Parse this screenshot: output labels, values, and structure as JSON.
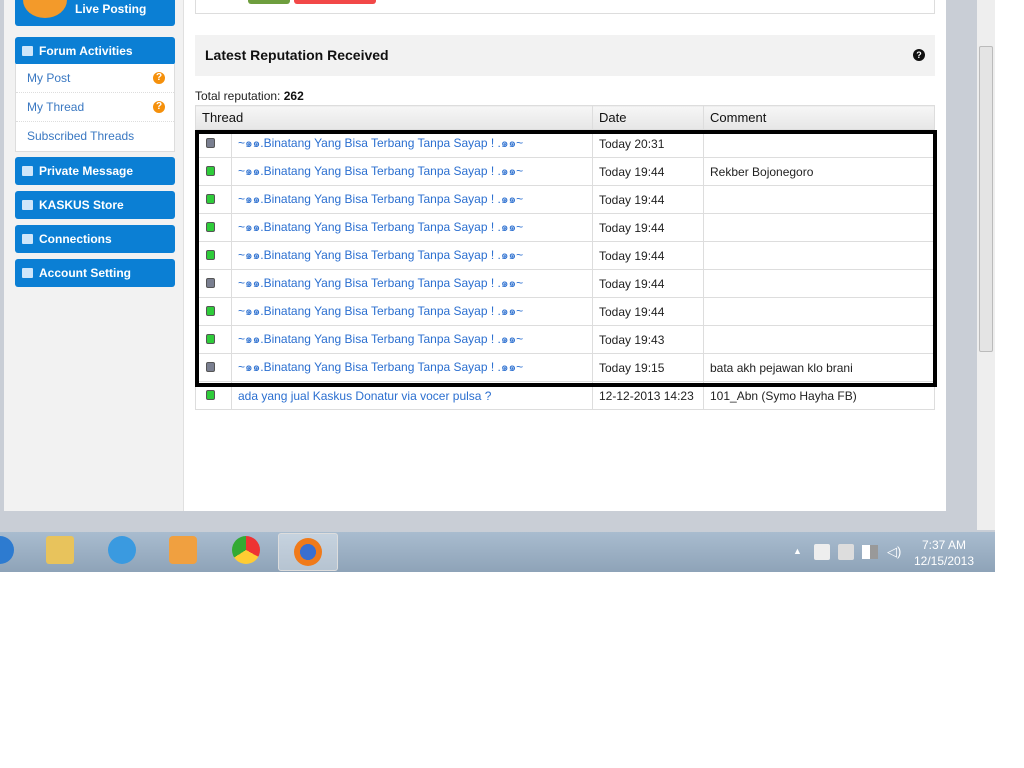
{
  "sidebar": {
    "live_posting": "Live Posting",
    "forum_activities": "Forum Activities",
    "sub_items": [
      {
        "label": "My Post",
        "badge": "?"
      },
      {
        "label": "My Thread",
        "badge": "?"
      },
      {
        "label": "Subscribed Threads"
      }
    ],
    "buttons": [
      "Private Message",
      "KASKUS Store",
      "Connections",
      "Account Setting"
    ]
  },
  "main": {
    "title": "Latest Reputation Received",
    "help": "?",
    "total_label": "Total reputation:",
    "total_value": "262",
    "columns": [
      "Thread",
      "Date",
      "Comment"
    ],
    "rows": [
      {
        "status": "gray",
        "thread": "~๑๑.Binatang Yang Bisa Terbang Tanpa Sayap ! .๑๑~",
        "date": "Today 20:31",
        "comment": ""
      },
      {
        "status": "green",
        "thread": "~๑๑.Binatang Yang Bisa Terbang Tanpa Sayap ! .๑๑~",
        "date": "Today 19:44",
        "comment": "Rekber Bojonegoro"
      },
      {
        "status": "green",
        "thread": "~๑๑.Binatang Yang Bisa Terbang Tanpa Sayap ! .๑๑~",
        "date": "Today 19:44",
        "comment": ""
      },
      {
        "status": "green",
        "thread": "~๑๑.Binatang Yang Bisa Terbang Tanpa Sayap ! .๑๑~",
        "date": "Today 19:44",
        "comment": ""
      },
      {
        "status": "green",
        "thread": "~๑๑.Binatang Yang Bisa Terbang Tanpa Sayap ! .๑๑~",
        "date": "Today 19:44",
        "comment": ""
      },
      {
        "status": "gray",
        "thread": "~๑๑.Binatang Yang Bisa Terbang Tanpa Sayap ! .๑๑~",
        "date": "Today 19:44",
        "comment": ""
      },
      {
        "status": "green",
        "thread": "~๑๑.Binatang Yang Bisa Terbang Tanpa Sayap ! .๑๑~",
        "date": "Today 19:44",
        "comment": ""
      },
      {
        "status": "green",
        "thread": "~๑๑.Binatang Yang Bisa Terbang Tanpa Sayap ! .๑๑~",
        "date": "Today 19:43",
        "comment": ""
      },
      {
        "status": "gray",
        "thread": "~๑๑.Binatang Yang Bisa Terbang Tanpa Sayap ! .๑๑~",
        "date": "Today 19:15",
        "comment": "bata akh pejawan klo brani"
      },
      {
        "status": "green",
        "thread": "ada yang jual Kaskus Donatur via vocer pulsa ?",
        "date": "12-12-2013 14:23",
        "comment": "101_Abn (Symo Hayha FB)"
      }
    ]
  },
  "colors": {
    "accent": "#0b7fd4",
    "green": "#2ecc3a",
    "gray": "#7a7f90",
    "link": "#2b6fd0"
  },
  "taskbar": {
    "apps": [
      "explorer-icon",
      "internet-explorer-icon",
      "media-player-icon",
      "chrome-icon",
      "firefox-icon"
    ],
    "time": "7:37 AM",
    "date": "12/15/2013"
  }
}
